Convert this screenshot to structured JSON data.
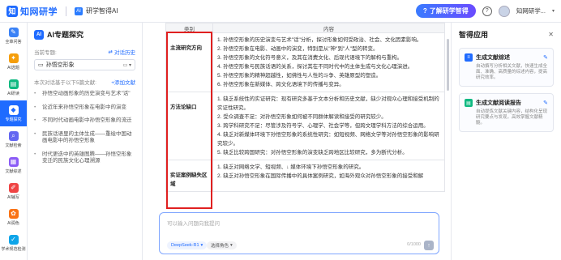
{
  "header": {
    "logo_mark": "知",
    "logo_text": "知网研学",
    "sub_brand_icon": "AI",
    "sub_brand": "研学智得AI",
    "promo_label": "了解研学智得",
    "help_glyph": "?",
    "user_name": "知网研学...",
    "user_caret": "▾"
  },
  "rail": {
    "items": [
      {
        "label": "全章问答",
        "icon": "chat-icon",
        "color": "#3b82f6"
      },
      {
        "label": "AI选题",
        "icon": "lightbulb-icon",
        "color": "#f59e0b"
      },
      {
        "label": "AI研读",
        "icon": "book-icon",
        "color": "#10b981"
      },
      {
        "label": "专题探究",
        "icon": "flask-icon",
        "color": "#1f6bff",
        "active": true
      },
      {
        "label": "文献检索",
        "icon": "search-icon",
        "color": "#6366f1"
      },
      {
        "label": "文献综述",
        "icon": "doc-icon",
        "color": "#8b5cf6"
      },
      {
        "label": "AI辅写",
        "icon": "pen-icon",
        "color": "#ef4444"
      },
      {
        "label": "AI润色",
        "icon": "brush-icon",
        "color": "#f97316"
      },
      {
        "label": "学术规范检测",
        "icon": "check-icon",
        "color": "#0ea5e9"
      }
    ]
  },
  "left_panel": {
    "title": "AI专题探究",
    "current_label": "当前专题:",
    "compare_label": "对话历史",
    "topic_value": "孙悟空形象",
    "questions_label": "本次对话基于以下5篇文献:",
    "add_label": "+添加文献",
    "questions": [
      {
        "num": "1.",
        "text": "孙悟空动画形象的历史演变与艺术\"话\"",
        "active": false
      },
      {
        "num": "2.",
        "text": "论近年来孙悟空形象在电影中的演变",
        "active": false
      },
      {
        "num": "3.",
        "text": "不同时代动画电影中孙悟空形象的流迁",
        "active": false
      },
      {
        "num": "4.",
        "text": "民族话语里的主体生成——重绘中国动画电影中的孙悟空形象",
        "active": false
      },
      {
        "num": "5.",
        "text": "时代更迭中的英雄图腾——孙悟空形象变迁的民族文化心理溯源",
        "active": false
      }
    ]
  },
  "table": {
    "col_category": "类别",
    "col_content": "内容",
    "rows": [
      {
        "category": "主流研究方向",
        "lines": [
          "1. 孙悟空形象的历史演变与艺术\"话\"分析，探讨形象如何受政治、社会、文化因素影响。",
          "2. 孙悟空形象在电影、动画中的演变，特别是从\"神\"到\"人\"型的转变。",
          "3. 孙悟空形象的文化符号意义，及其在消费文化、后现代语境下的解构与重构。",
          "4. 孙悟空形象与民族话语的关系，探讨其在不同时代中的主体生成与文化心理演进。",
          "5. 孙悟空形象的精神超越性，如佛性与人性的斗争、英雄原型的塑造。",
          "6. 孙悟空形象在新媒体、跨文化语境下的传播与变异。"
        ]
      },
      {
        "category": "方法论缺口",
        "lines": [
          "1. 缺乏系统性的实证研究：现有研究多基于文本分析和历史文献，缺少对观众心理和接受机制的实证性研究。",
          "2. 受众调查不足：对孙悟空形象如何被不同群体解读和接受的研究较少。",
          "3. 跨学科研究不足：尽管涉及符号学、心理学、社会学等，但跨文理学科方法的综合运用。",
          "4. 缺乏对新媒体环境下孙悟空形象的系统性研究：如短视频、网络文学等对孙悟空形象的影响研究较少。",
          "5. 缺乏比较跨国研究：对孙悟空形象的演变缺乏跨地区比较研究，多为断代分析。"
        ]
      },
      {
        "category": "实证案例缺失区域",
        "lines": [
          "1. 缺乏对网络文学、短视频、↓ 媒体环境下孙悟空形象的研究。",
          "2. 缺乏对孙悟空形象在国际传播中的具体案例研究，如海外观众对孙悟空形象的接受和解"
        ]
      }
    ]
  },
  "input": {
    "placeholder": "可以输入问题向我提问",
    "model": "DeepSeek-R1",
    "tool": "选择角色",
    "count": "0/1000",
    "send_glyph": "↑"
  },
  "right_panel": {
    "title": "智得应用",
    "close_glyph": "✕",
    "apps": [
      {
        "title": "生成文献综述",
        "desc": "自动撰写分析相关文献，快速生成全面、准确、高质量的综述内容，提高研究效率。",
        "icon_color": "#1f6bff",
        "icon": "list-icon"
      },
      {
        "title": "生成文献阅读报告",
        "desc": "自动提炼文献关键内容，结构化呈现研究要点与发现，高效掌握文献精髓。",
        "icon_color": "#10b981",
        "icon": "report-icon"
      }
    ]
  }
}
